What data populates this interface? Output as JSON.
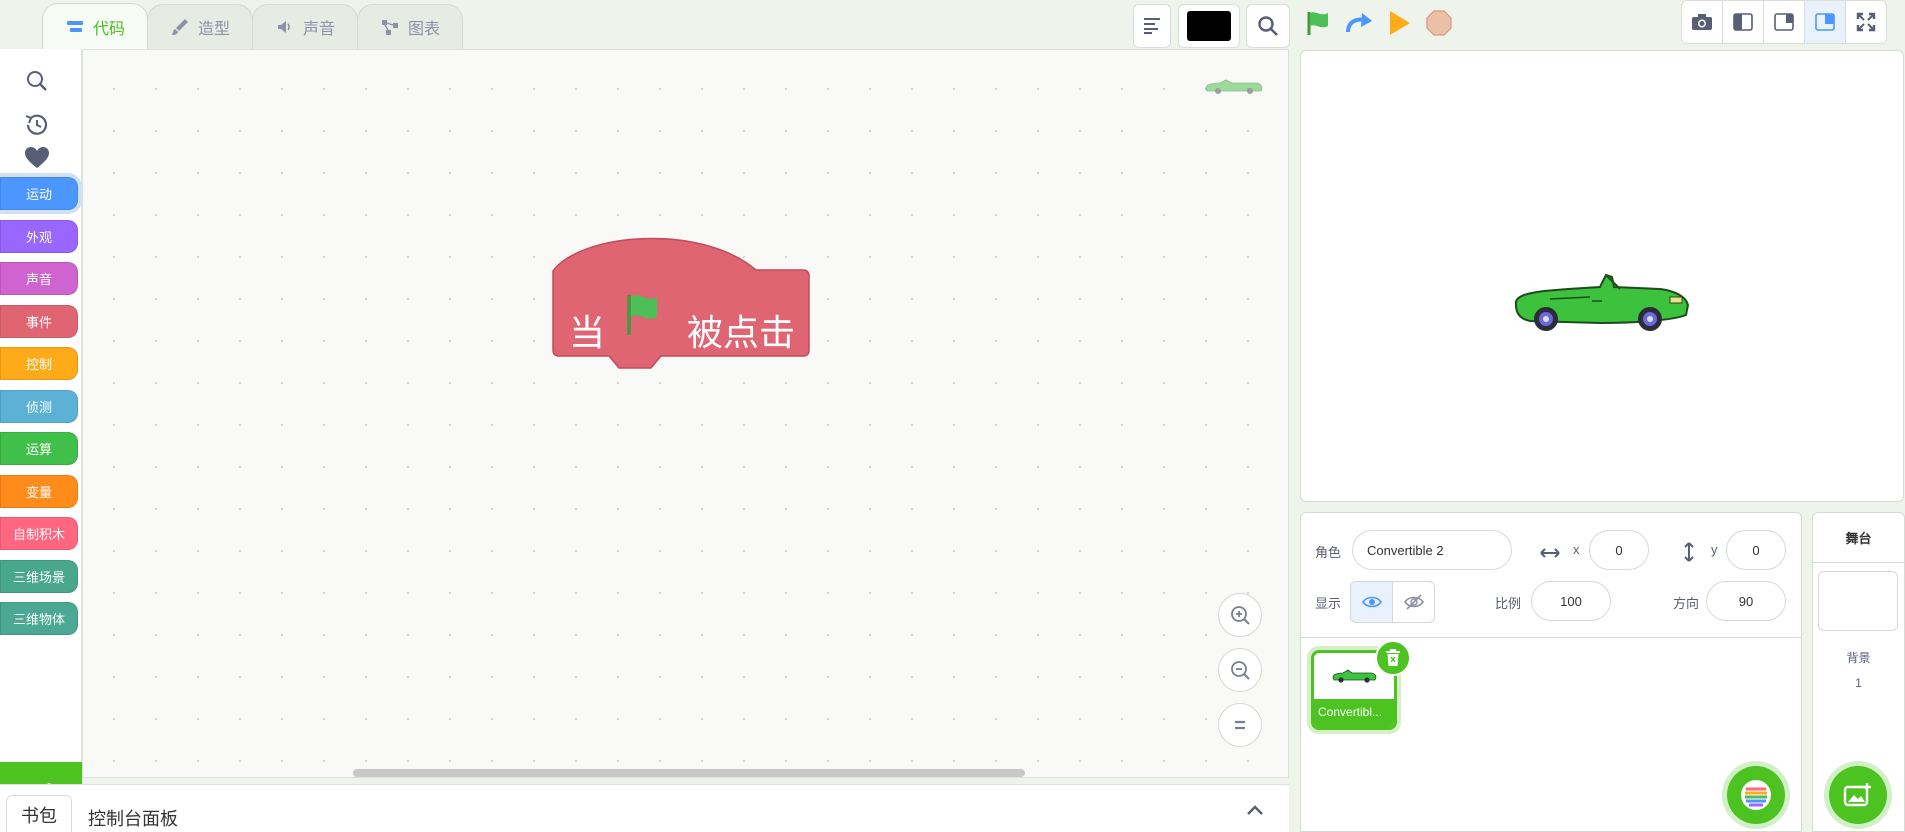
{
  "tabs": [
    {
      "label": "代码",
      "icon": "code-icon",
      "active": true
    },
    {
      "label": "造型",
      "icon": "brush-icon",
      "active": false
    },
    {
      "label": "声音",
      "icon": "speaker-icon",
      "active": false
    },
    {
      "label": "图表",
      "icon": "chart-icon",
      "active": false
    }
  ],
  "toolbar": {
    "align_icon": "align-left-icon",
    "color_value": "#000000",
    "search_icon": "search-icon",
    "run_controls": [
      "green-flag-icon",
      "redo-icon",
      "play-icon",
      "stop-icon"
    ],
    "view_modes": [
      "camera-icon",
      "small-stage-icon",
      "normal-stage-icon",
      "large-stage-icon",
      "fullscreen-icon"
    ]
  },
  "palette": {
    "tools": [
      "search-icon",
      "history-icon",
      "heart-icon"
    ],
    "categories": [
      {
        "label": "运动",
        "color": "#4c97ff"
      },
      {
        "label": "外观",
        "color": "#9966ff"
      },
      {
        "label": "声音",
        "color": "#cf63cf"
      },
      {
        "label": "事件",
        "color": "#e06573"
      },
      {
        "label": "控制",
        "color": "#ffab19"
      },
      {
        "label": "侦测",
        "color": "#5cb1d6"
      },
      {
        "label": "运算",
        "color": "#40bf4a"
      },
      {
        "label": "变量",
        "color": "#ff8c1a"
      },
      {
        "label": "自制积木",
        "color": "#ff6680"
      },
      {
        "label": "三维场景",
        "color": "#4aa88a"
      },
      {
        "label": "三维物体",
        "color": "#4aa893"
      }
    ]
  },
  "workspace": {
    "hat_block": {
      "prefix": "当",
      "suffix": "被点击",
      "color": "#e06573"
    }
  },
  "backpack": {
    "tab_label": "书包",
    "title": "控制台面板"
  },
  "sprite_info": {
    "sprite_label": "角色",
    "sprite_name": "Convertible 2",
    "x_label": "x",
    "x_value": "0",
    "y_label": "y",
    "y_value": "0",
    "show_label": "显示",
    "size_label": "比例",
    "size_value": "100",
    "direction_label": "方向",
    "direction_value": "90"
  },
  "sprites": [
    {
      "name": "Convertibl..."
    }
  ],
  "backdrop": {
    "title": "舞台",
    "label": "背景",
    "count": "1"
  },
  "colors": {
    "accent_green": "#4cc321",
    "event_red": "#e06573"
  }
}
